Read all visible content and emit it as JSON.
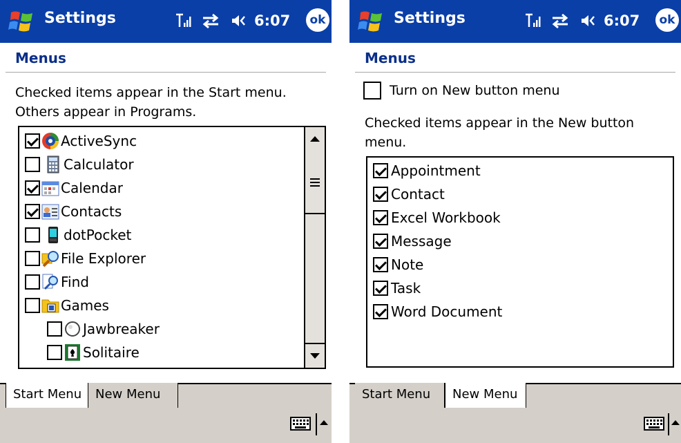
{
  "left_screen": {
    "app_title": "Settings",
    "time": "6:07",
    "ok_label": "ok",
    "page_title": "Menus",
    "description": "Checked items appear in the Start menu. Others appear in Programs.",
    "items": [
      {
        "label": "ActiveSync",
        "checked": true,
        "icon": "activesync-icon"
      },
      {
        "label": "Calculator",
        "checked": false,
        "icon": "calculator-icon"
      },
      {
        "label": "Calendar",
        "checked": true,
        "icon": "calendar-icon"
      },
      {
        "label": "Contacts",
        "checked": true,
        "icon": "contacts-icon"
      },
      {
        "label": "dotPocket",
        "checked": false,
        "icon": "dotpocket-icon"
      },
      {
        "label": "File Explorer",
        "checked": false,
        "icon": "file-explorer-icon"
      },
      {
        "label": "Find",
        "checked": false,
        "icon": "find-icon"
      },
      {
        "label": "Games",
        "checked": false,
        "icon": "games-folder-icon"
      },
      {
        "label": "Jawbreaker",
        "checked": false,
        "icon": "jawbreaker-icon"
      },
      {
        "label": "Solitaire",
        "checked": false,
        "icon": "solitaire-icon"
      }
    ],
    "tabs": [
      {
        "label": "Start Menu",
        "active": true
      },
      {
        "label": "New Menu",
        "active": false
      }
    ]
  },
  "right_screen": {
    "app_title": "Settings",
    "time": "6:07",
    "ok_label": "ok",
    "page_title": "Menus",
    "new_button_option": {
      "label": "Turn on New button menu",
      "checked": false
    },
    "description": "Checked items appear in the New button menu.",
    "items": [
      {
        "label": "Appointment",
        "checked": true
      },
      {
        "label": "Contact",
        "checked": true
      },
      {
        "label": "Excel Workbook",
        "checked": true
      },
      {
        "label": "Message",
        "checked": true
      },
      {
        "label": "Note",
        "checked": true
      },
      {
        "label": "Task",
        "checked": true
      },
      {
        "label": "Word Document",
        "checked": true
      }
    ],
    "tabs": [
      {
        "label": "Start Menu",
        "active": false
      },
      {
        "label": "New Menu",
        "active": true
      }
    ]
  },
  "colors": {
    "titlebar": "#0a3fa8",
    "page_title": "#0a2e8a",
    "tabbar": "#d4cfc8"
  }
}
